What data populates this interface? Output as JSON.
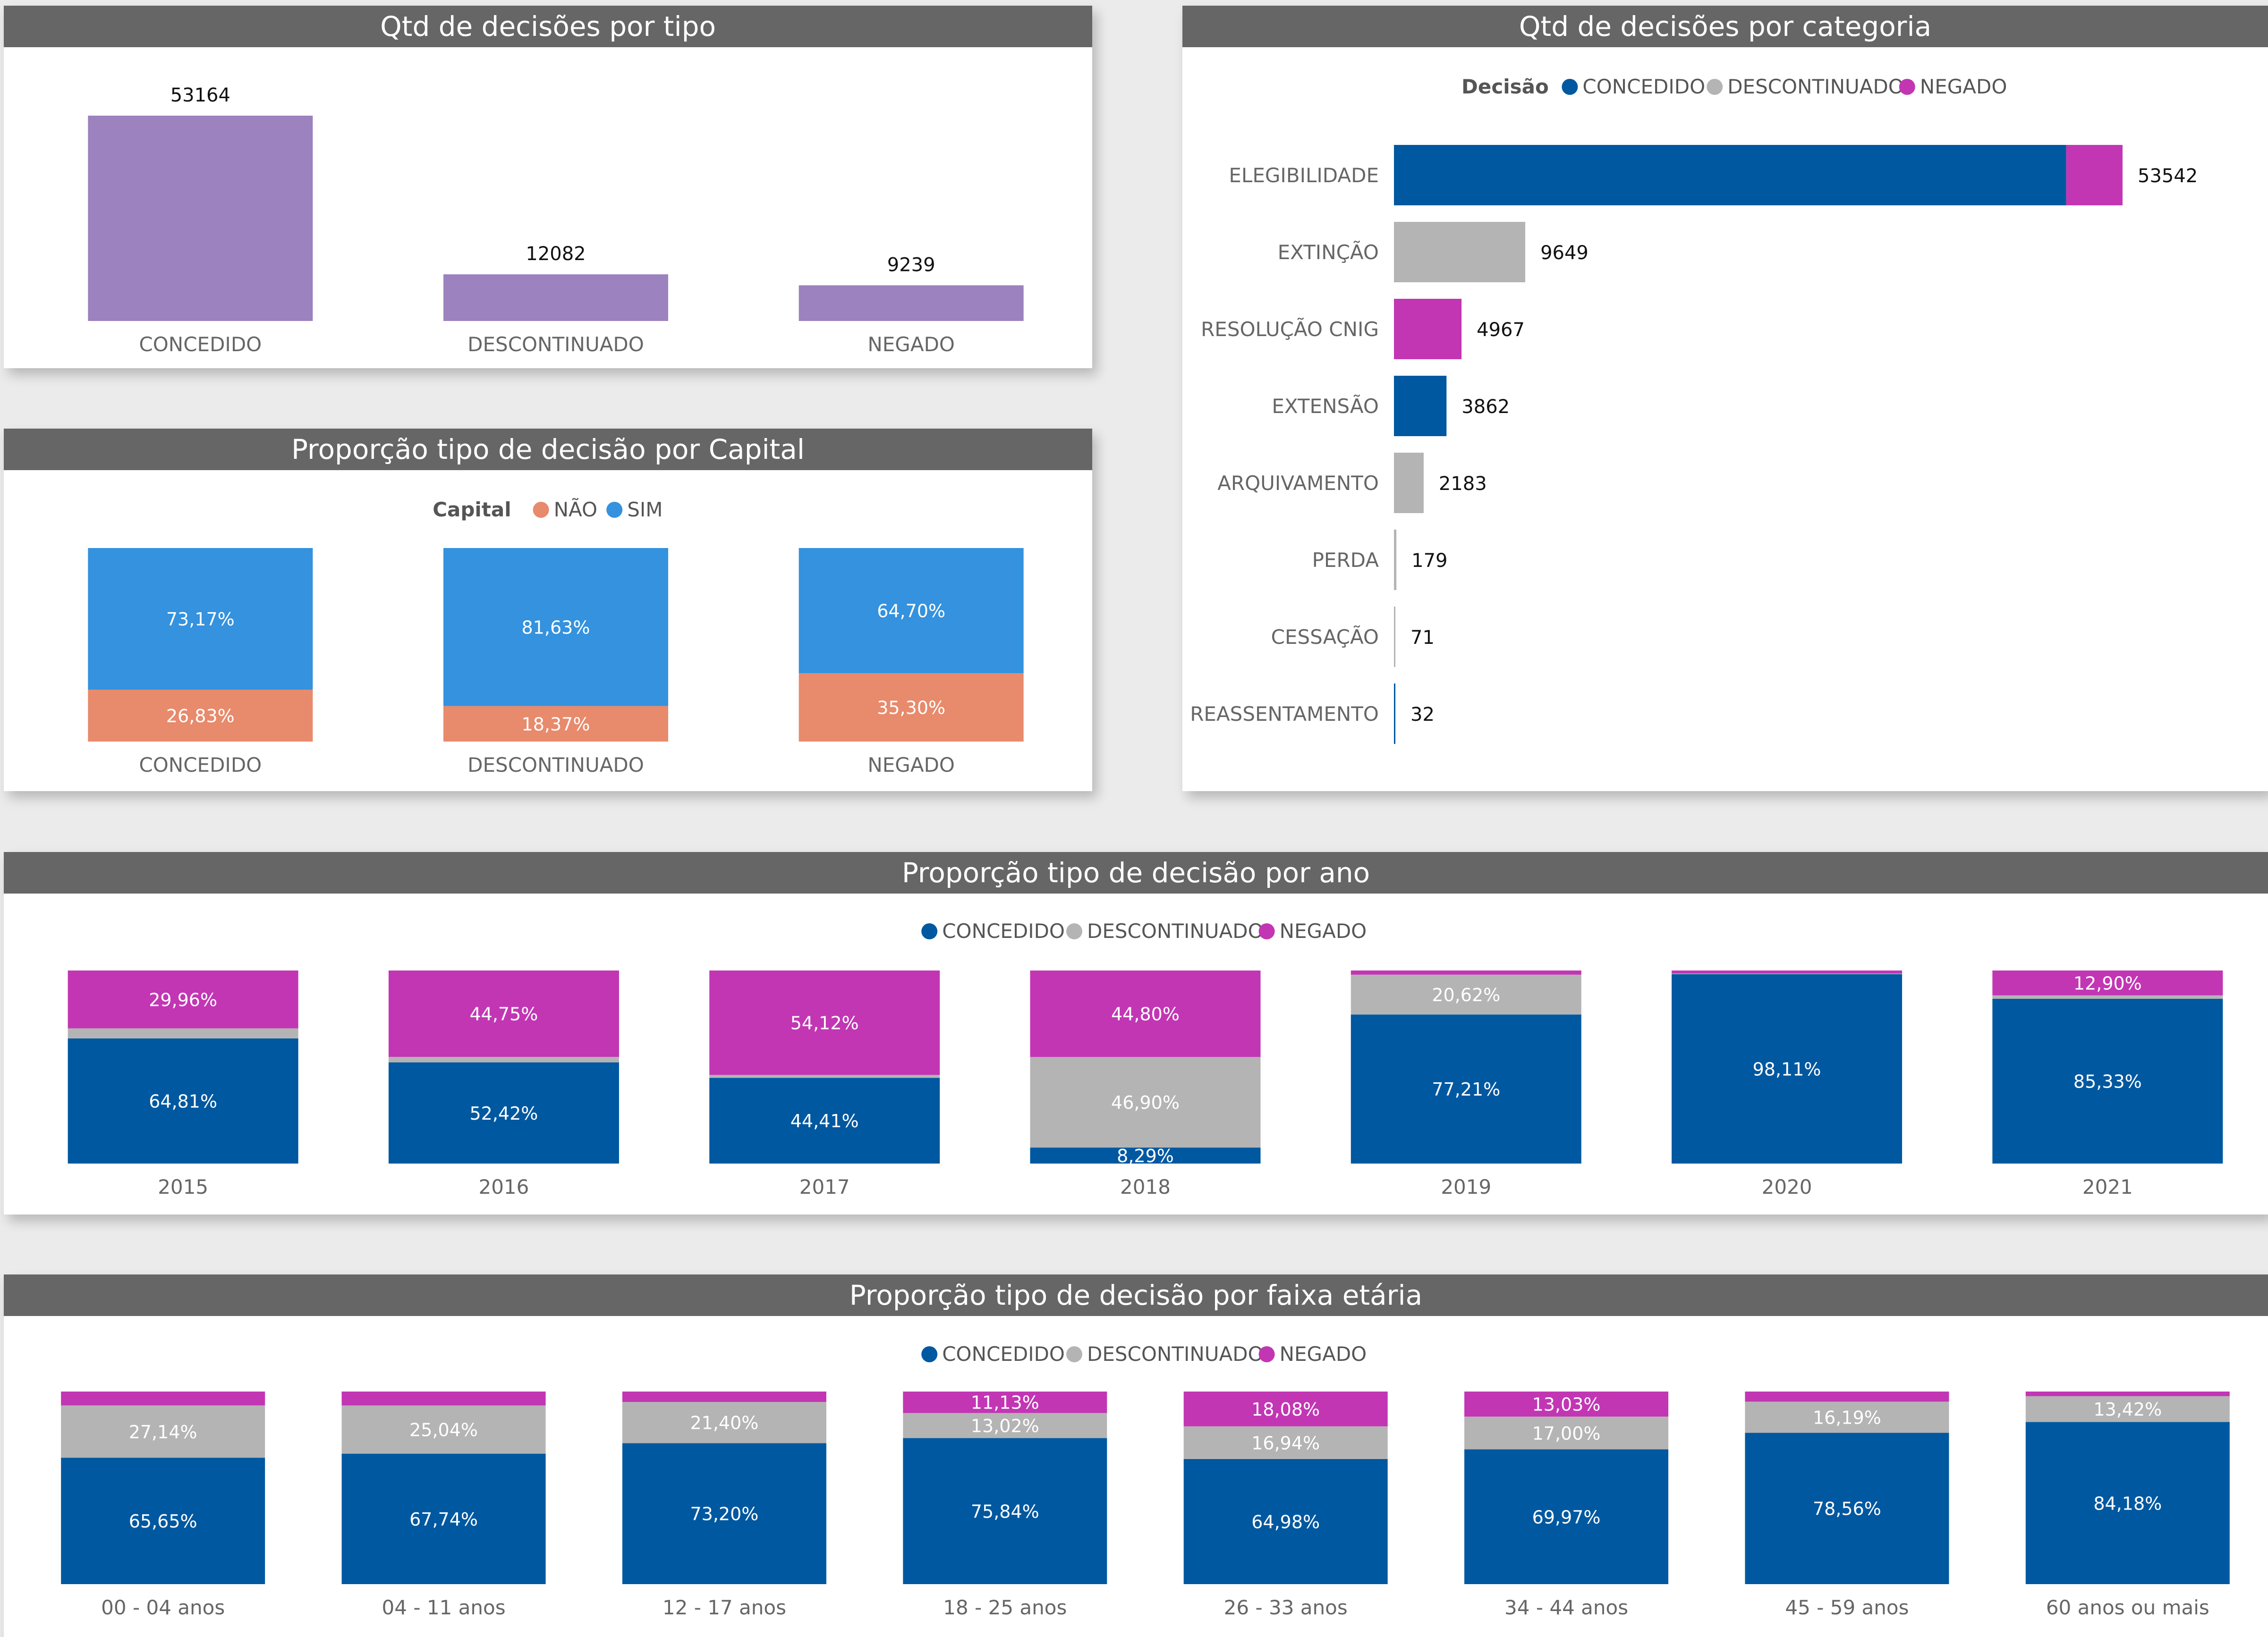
{
  "colors": {
    "concedido": "#0058A0",
    "descontinuado": "#B4B4B4",
    "negado": "#C236B4",
    "tipo_bar": "#9C82BE",
    "capital_nao": "#E88A6C",
    "capital_sim": "#3492DE",
    "title_bg": "#666666"
  },
  "legend_labels": {
    "concedido": "CONCEDIDO",
    "descontinuado": "DESCONTINUADO",
    "negado": "NEGADO"
  },
  "chart_data": [
    {
      "id": "tipo",
      "type": "bar",
      "title": "Qtd de decisões por tipo",
      "categories": [
        "CONCEDIDO",
        "DESCONTINUADO",
        "NEGADO"
      ],
      "values": [
        53164,
        12082,
        9239
      ],
      "data_labels": [
        "53164",
        "12082",
        "9239"
      ],
      "ylim": [
        0,
        53164
      ],
      "grid": false,
      "legend": "none"
    },
    {
      "id": "capital",
      "type": "bar",
      "stacked": "percent",
      "title": "Proporção tipo de decisão por Capital",
      "legend_title": "Capital",
      "legend": "top-center",
      "categories": [
        "CONCEDIDO",
        "DESCONTINUADO",
        "NEGADO"
      ],
      "series": [
        {
          "name": "NÃO",
          "color_key": "capital_nao",
          "values": [
            26.83,
            18.37,
            35.3
          ],
          "labels": [
            "26,83%",
            "18,37%",
            "35,30%"
          ]
        },
        {
          "name": "SIM",
          "color_key": "capital_sim",
          "values": [
            73.17,
            81.63,
            64.7
          ],
          "labels": [
            "73,17%",
            "81,63%",
            "64,70%"
          ]
        }
      ]
    },
    {
      "id": "categoria",
      "type": "bar",
      "orientation": "horizontal",
      "stacked": true,
      "title": "Qtd de decisões por categoria",
      "legend_title": "Decisão",
      "legend": "top-center",
      "categories": [
        "ELEGIBILIDADE",
        "EXTINÇÃO",
        "RESOLUÇÃO CNIG",
        "EXTENSÃO",
        "ARQUIVAMENTO",
        "PERDA",
        "CESSAÇÃO",
        "REASSENTAMENTO"
      ],
      "series": [
        {
          "name": "CONCEDIDO",
          "color_key": "concedido",
          "values": [
            49400,
            0,
            0,
            3862,
            0,
            0,
            0,
            32
          ]
        },
        {
          "name": "DESCONTINUADO",
          "color_key": "descontinuado",
          "values": [
            0,
            9649,
            0,
            0,
            2183,
            179,
            71,
            0
          ]
        },
        {
          "name": "NEGADO",
          "color_key": "negado",
          "values": [
            4142,
            0,
            4967,
            0,
            0,
            0,
            0,
            0
          ]
        }
      ],
      "totals": [
        53542,
        9649,
        4967,
        3862,
        2183,
        179,
        71,
        32
      ],
      "total_labels": [
        "53542",
        "9649",
        "4967",
        "3862",
        "2183",
        "179",
        "71",
        "32"
      ],
      "xlim": [
        0,
        53542
      ]
    },
    {
      "id": "ano",
      "type": "bar",
      "stacked": "percent",
      "title": "Proporção tipo de decisão por ano",
      "legend": "top-center",
      "categories": [
        "2015",
        "2016",
        "2017",
        "2018",
        "2019",
        "2020",
        "2021"
      ],
      "series": [
        {
          "name": "CONCEDIDO",
          "color_key": "concedido",
          "values": [
            64.81,
            52.42,
            44.41,
            8.29,
            77.21,
            98.11,
            85.33
          ],
          "labels": [
            "64,81%",
            "52,42%",
            "44,41%",
            "8,29%",
            "77,21%",
            "98,11%",
            "85,33%"
          ]
        },
        {
          "name": "DESCONTINUADO",
          "color_key": "descontinuado",
          "values": [
            5.23,
            2.83,
            1.47,
            46.9,
            20.62,
            0.31,
            1.77
          ],
          "labels": [
            "",
            "",
            "",
            "46,90%",
            "20,62%",
            "",
            ""
          ]
        },
        {
          "name": "NEGADO",
          "color_key": "negado",
          "values": [
            29.96,
            44.75,
            54.12,
            44.8,
            2.17,
            1.58,
            12.9
          ],
          "labels": [
            "29,96%",
            "44,75%",
            "54,12%",
            "44,80%",
            "",
            "",
            "12,90%"
          ]
        }
      ]
    },
    {
      "id": "faixa",
      "type": "bar",
      "stacked": "percent",
      "title": "Proporção tipo de decisão por faixa etária",
      "legend": "top-center",
      "categories": [
        "00 - 04 anos",
        "04 - 11 anos",
        "12 - 17 anos",
        "18 - 25 anos",
        "26 - 33 anos",
        "34 - 44 anos",
        "45 - 59 anos",
        "60 anos ou mais"
      ],
      "series": [
        {
          "name": "CONCEDIDO",
          "color_key": "concedido",
          "values": [
            65.65,
            67.74,
            73.2,
            75.84,
            64.98,
            69.97,
            78.56,
            84.18
          ],
          "labels": [
            "65,65%",
            "67,74%",
            "73,20%",
            "75,84%",
            "64,98%",
            "69,97%",
            "78,56%",
            "84,18%"
          ]
        },
        {
          "name": "DESCONTINUADO",
          "color_key": "descontinuado",
          "values": [
            27.14,
            25.04,
            21.4,
            13.02,
            16.94,
            17.0,
            16.19,
            13.42
          ],
          "labels": [
            "27,14%",
            "25,04%",
            "21,40%",
            "13,02%",
            "16,94%",
            "17,00%",
            "16,19%",
            "13,42%"
          ]
        },
        {
          "name": "NEGADO",
          "color_key": "negado",
          "values": [
            7.21,
            7.22,
            5.4,
            11.13,
            18.08,
            13.03,
            5.25,
            2.4
          ],
          "labels": [
            "",
            "",
            "",
            "11,13%",
            "18,08%",
            "13,03%",
            "",
            ""
          ]
        }
      ]
    }
  ]
}
